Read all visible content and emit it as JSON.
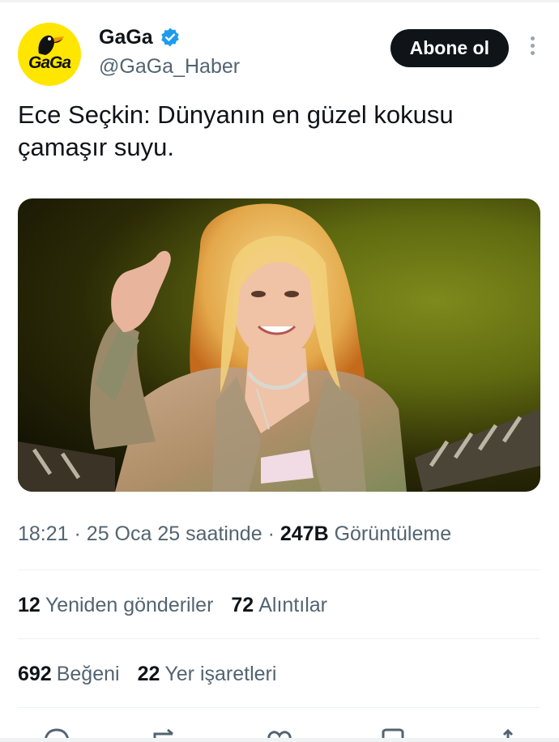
{
  "account": {
    "display_name": "GaGa",
    "handle": "@GaGa_Haber",
    "avatar_text": "GaGa",
    "verified": true
  },
  "follow_button": {
    "label": "Abone ol"
  },
  "tweet": {
    "text": "Ece Seçkin: Dünyanın en güzel kokusu çamaşır suyu."
  },
  "meta": {
    "time": "18:21",
    "date": "25 Oca 25 saatinde",
    "separator": "·",
    "views_count": "247B",
    "views_label": "Görüntüleme"
  },
  "stats": {
    "retweets_count": "12",
    "retweets_label": "Yeniden gönderiler",
    "quotes_count": "72",
    "quotes_label": "Alıntılar",
    "likes_count": "692",
    "likes_label": "Beğeni",
    "bookmarks_count": "22",
    "bookmarks_label": "Yer işaretleri"
  },
  "icons": {
    "verified": "verified-badge-icon",
    "more": "more-options-icon",
    "reply": "reply-icon",
    "retweet": "retweet-icon",
    "like": "heart-icon",
    "bookmark": "bookmark-icon",
    "share": "share-icon"
  },
  "colors": {
    "verified": "#1d9bf0",
    "avatar_bg": "#ffe600",
    "button_bg": "#0f1419",
    "secondary_text": "#536471"
  }
}
